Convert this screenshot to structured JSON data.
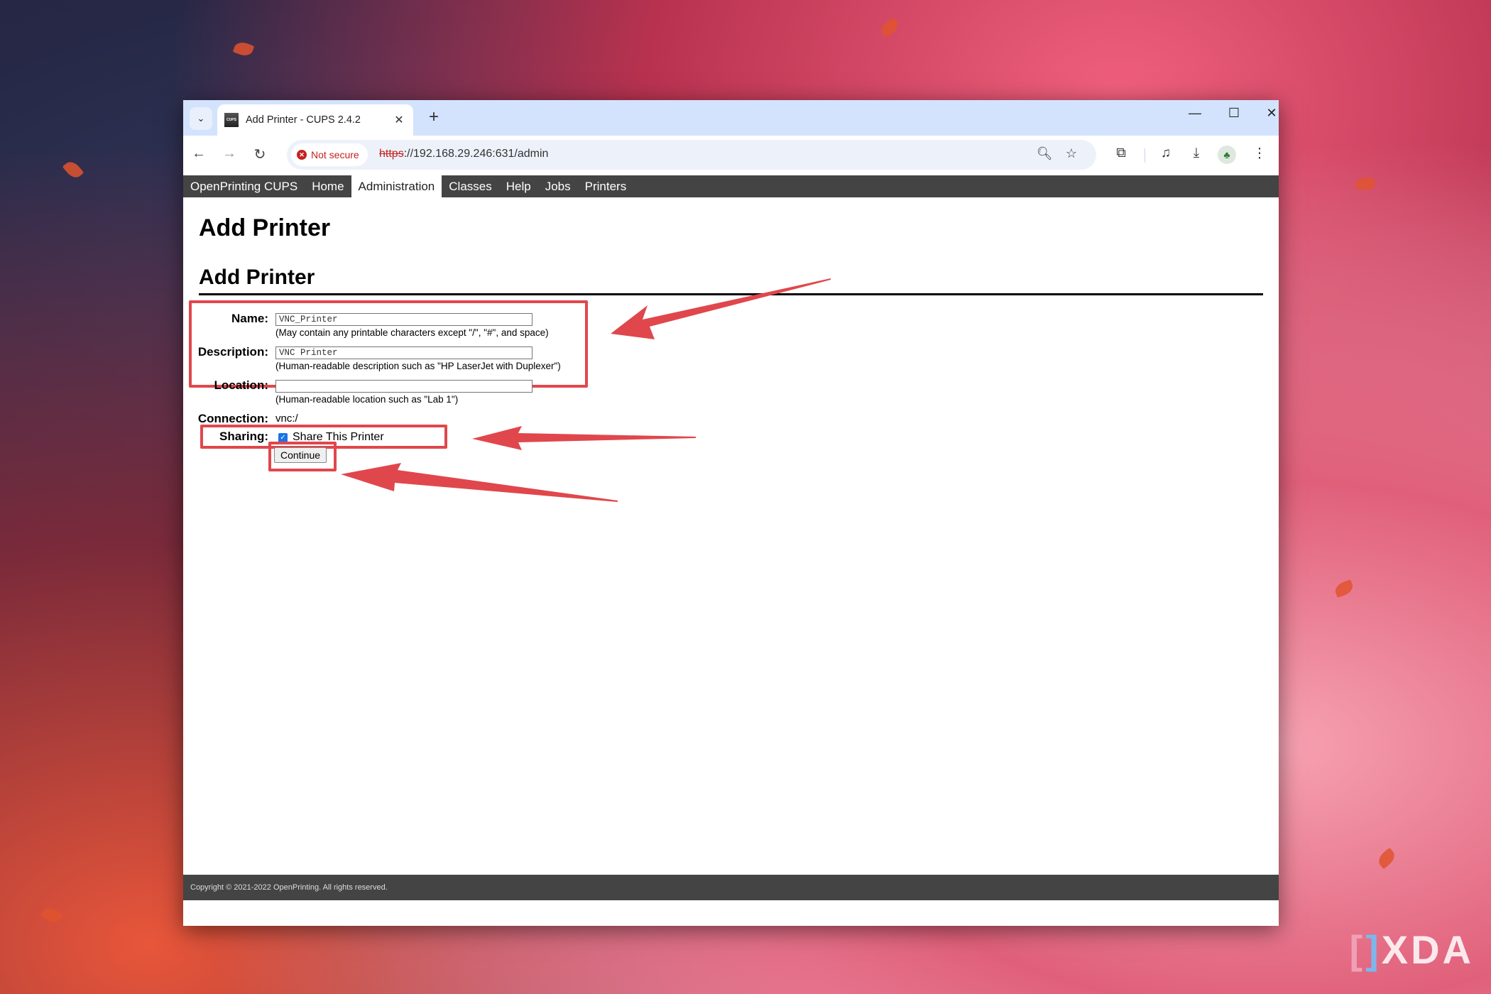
{
  "browser": {
    "tab_title": "Add Printer - CUPS 2.4.2",
    "tab_favicon_text": "CUPS",
    "security_chip": "Not secure",
    "url_scheme": "https",
    "url_rest": "://192.168.29.246:631/admin",
    "icons": {
      "tab_search": "chevron-down-icon",
      "tab_close": "close-icon",
      "new_tab": "plus-icon",
      "minimize": "minimize-icon",
      "maximize": "maximize-icon",
      "close_window": "close-icon",
      "back": "arrow-left-icon",
      "forward": "arrow-right-icon",
      "reload": "reload-icon",
      "zoom": "zoom-out-icon",
      "bookmark": "star-icon",
      "extensions": "puzzle-icon",
      "media": "media-control-icon",
      "downloads": "download-icon",
      "profile": "avatar",
      "menu": "kebab-menu-icon"
    }
  },
  "cups_nav": {
    "items": [
      {
        "label": "OpenPrinting CUPS",
        "active": false
      },
      {
        "label": "Home",
        "active": false
      },
      {
        "label": "Administration",
        "active": true
      },
      {
        "label": "Classes",
        "active": false
      },
      {
        "label": "Help",
        "active": false
      },
      {
        "label": "Jobs",
        "active": false
      },
      {
        "label": "Printers",
        "active": false
      }
    ]
  },
  "page": {
    "title": "Add Printer",
    "section_title": "Add Printer",
    "form": {
      "name_label": "Name:",
      "name_value": "VNC_Printer",
      "name_hint": "(May contain any printable characters except \"/\", \"#\", and space)",
      "description_label": "Description:",
      "description_value": "VNC Printer",
      "description_hint": "(Human-readable description such as \"HP LaserJet with Duplexer\")",
      "location_label": "Location:",
      "location_value": "",
      "location_hint": "(Human-readable location such as \"Lab 1\")",
      "connection_label": "Connection:",
      "connection_value": "vnc:/",
      "sharing_label": "Sharing:",
      "sharing_checked": true,
      "sharing_option": "Share This Printer",
      "continue_label": "Continue"
    }
  },
  "footer": {
    "copyright": "Copyright © 2021-2022 OpenPrinting. All rights reserved."
  },
  "annotations": {
    "highlight_color": "#e0474c"
  },
  "watermark": {
    "brand": "XDA"
  }
}
